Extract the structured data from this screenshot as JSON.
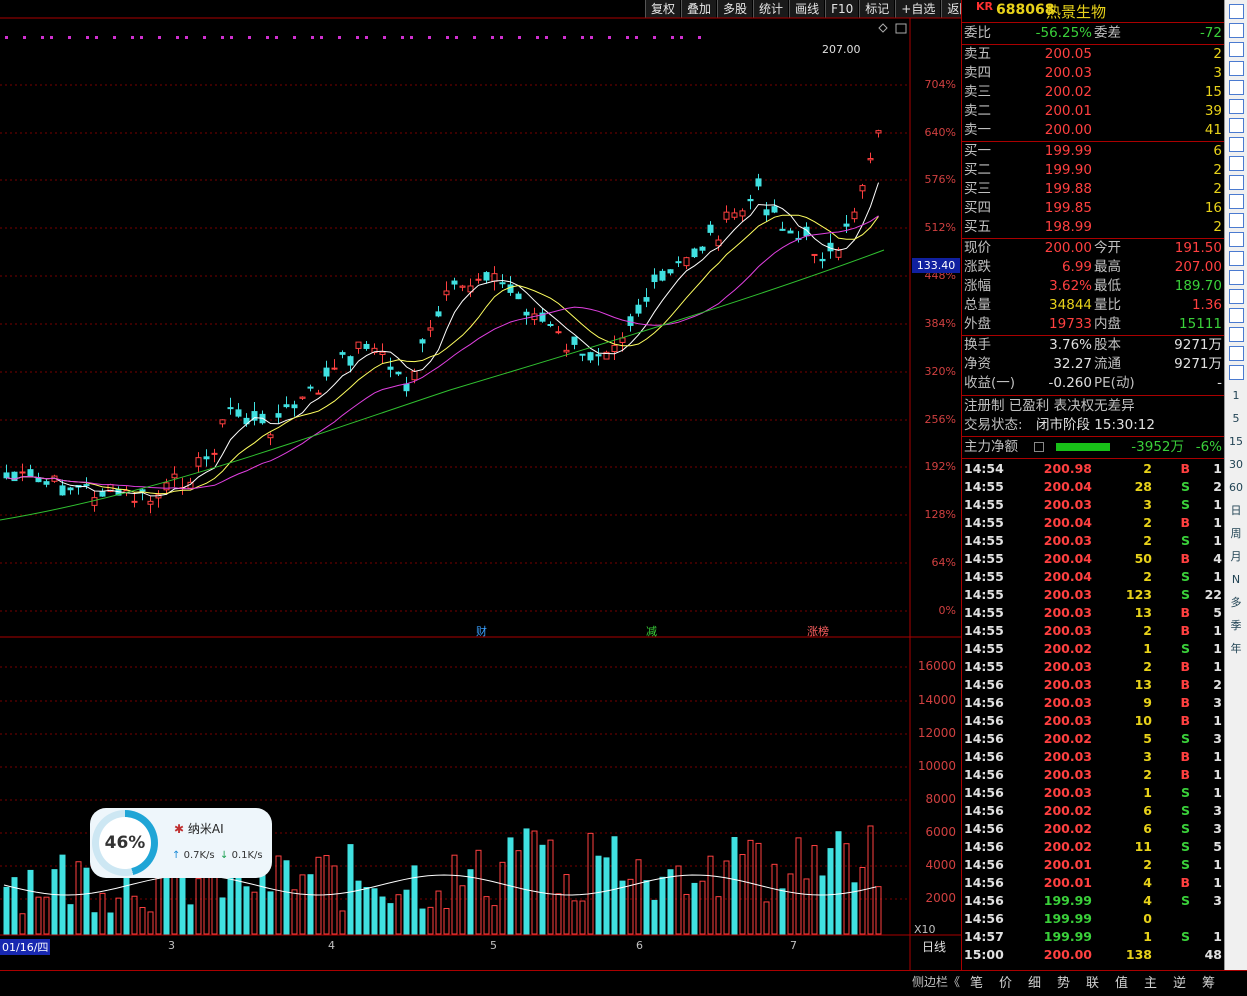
{
  "toolbar": [
    "复权",
    "叠加",
    "多股",
    "统计",
    "画线",
    "F10",
    "标记",
    "+自选",
    "返回"
  ],
  "header": {
    "market": "KR",
    "code": "688068",
    "name": "热景生物"
  },
  "quote": {
    "weibi_label": "委比",
    "weibi": "-56.25%",
    "weicha_label": "委差",
    "weicha": "-72",
    "asks": [
      {
        "l": "卖五",
        "p": "200.05",
        "v": "2"
      },
      {
        "l": "卖四",
        "p": "200.03",
        "v": "3"
      },
      {
        "l": "卖三",
        "p": "200.02",
        "v": "15"
      },
      {
        "l": "卖二",
        "p": "200.01",
        "v": "39"
      },
      {
        "l": "卖一",
        "p": "200.00",
        "v": "41"
      }
    ],
    "bids": [
      {
        "l": "买一",
        "p": "199.99",
        "v": "6"
      },
      {
        "l": "买二",
        "p": "199.90",
        "v": "2"
      },
      {
        "l": "买三",
        "p": "199.88",
        "v": "2"
      },
      {
        "l": "买四",
        "p": "199.85",
        "v": "16"
      },
      {
        "l": "买五",
        "p": "198.99",
        "v": "2"
      }
    ],
    "stats": [
      {
        "l1": "现价",
        "v1": "200.00",
        "l2": "今开",
        "v2": "191.50",
        "c1": "#ff4040",
        "c2": "#ff4040"
      },
      {
        "l1": "涨跌",
        "v1": "6.99",
        "l2": "最高",
        "v2": "207.00",
        "c1": "#ff4040",
        "c2": "#ff4040"
      },
      {
        "l1": "涨幅",
        "v1": "3.62%",
        "l2": "最低",
        "v2": "189.70",
        "c1": "#ff4040",
        "c2": "#3ad03a"
      },
      {
        "l1": "总量",
        "v1": "34844",
        "l2": "量比",
        "v2": "1.36",
        "c1": "#e8d21a",
        "c2": "#ff4040"
      },
      {
        "l1": "外盘",
        "v1": "19733",
        "l2": "内盘",
        "v2": "15111",
        "c1": "#ff4040",
        "c2": "#3ad03a"
      }
    ],
    "stats2": [
      {
        "l1": "换手",
        "v1": "3.76%",
        "l2": "股本",
        "v2": "9271万"
      },
      {
        "l1": "净资",
        "v1": "32.27",
        "l2": "流通",
        "v2": "9271万"
      },
      {
        "l1": "收益(一)",
        "v1": "-0.260",
        "l2": "PE(动)",
        "v2": "-"
      }
    ],
    "reg": "注册制 已盈利 表决权无差异",
    "status_label": "交易状态:",
    "status": "闭市阶段 15:30:12",
    "zl_label": "主力净额",
    "zl_value": "-3952万",
    "zl_pct": "-6%"
  },
  "ticks": [
    [
      "14:54",
      "200.98",
      "2",
      "B",
      "1"
    ],
    [
      "14:55",
      "200.04",
      "28",
      "S",
      "2"
    ],
    [
      "14:55",
      "200.03",
      "3",
      "S",
      "1"
    ],
    [
      "14:55",
      "200.04",
      "2",
      "B",
      "1"
    ],
    [
      "14:55",
      "200.03",
      "2",
      "S",
      "1"
    ],
    [
      "14:55",
      "200.04",
      "50",
      "B",
      "4"
    ],
    [
      "14:55",
      "200.04",
      "2",
      "S",
      "1"
    ],
    [
      "14:55",
      "200.03",
      "123",
      "S",
      "22"
    ],
    [
      "14:55",
      "200.03",
      "13",
      "B",
      "5"
    ],
    [
      "14:55",
      "200.03",
      "2",
      "B",
      "1"
    ],
    [
      "14:55",
      "200.02",
      "1",
      "S",
      "1"
    ],
    [
      "14:55",
      "200.03",
      "2",
      "B",
      "1"
    ],
    [
      "14:56",
      "200.03",
      "13",
      "B",
      "2"
    ],
    [
      "14:56",
      "200.03",
      "9",
      "B",
      "3"
    ],
    [
      "14:56",
      "200.03",
      "10",
      "B",
      "1"
    ],
    [
      "14:56",
      "200.02",
      "5",
      "S",
      "3"
    ],
    [
      "14:56",
      "200.03",
      "3",
      "B",
      "1"
    ],
    [
      "14:56",
      "200.03",
      "2",
      "B",
      "1"
    ],
    [
      "14:56",
      "200.03",
      "1",
      "S",
      "1"
    ],
    [
      "14:56",
      "200.02",
      "6",
      "S",
      "3"
    ],
    [
      "14:56",
      "200.02",
      "6",
      "S",
      "3"
    ],
    [
      "14:56",
      "200.02",
      "11",
      "S",
      "5"
    ],
    [
      "14:56",
      "200.01",
      "2",
      "S",
      "1"
    ],
    [
      "14:56",
      "200.01",
      "4",
      "B",
      "1"
    ],
    [
      "14:56",
      "199.99",
      "4",
      "S",
      "3"
    ],
    [
      "14:56",
      "199.99",
      "0",
      "",
      ""
    ],
    [
      "14:57",
      "199.99",
      "1",
      "S",
      "1"
    ],
    [
      "15:00",
      "200.00",
      "138",
      "",
      "48"
    ]
  ],
  "price_axis": [
    "704%",
    "640%",
    "576%",
    "512%",
    "448%",
    "384%",
    "320%",
    "256%",
    "192%",
    "128%",
    "64%",
    "0%"
  ],
  "high_label": "207.00",
  "cur_price": "133.40",
  "vol_axis": [
    "16000",
    "14000",
    "12000",
    "10000",
    "8000",
    "6000",
    "4000",
    "2000"
  ],
  "vol_unit": "X10",
  "date_labels": [
    {
      "t": "01/16/四"
    },
    {
      "t": "3"
    },
    {
      "t": "4"
    },
    {
      "t": "5"
    },
    {
      "t": "6"
    },
    {
      "t": "7"
    }
  ],
  "markers": [
    {
      "t": "财",
      "c": "#3aa0ff"
    },
    {
      "t": "减",
      "c": "#3ad03a"
    },
    {
      "t": "涨榜",
      "c": "#ff6060"
    }
  ],
  "period_label": "日线",
  "sidebar_toggle": "侧边栏《",
  "bottom_tabs": [
    "笔",
    "价",
    "细",
    "势",
    "联",
    "值",
    "主",
    "逆",
    "筹"
  ],
  "side_texts": [
    "1",
    "5",
    "15",
    "30",
    "60",
    "日",
    "周",
    "月",
    "N",
    "多",
    "季",
    "年"
  ],
  "ai": {
    "pct": "46%",
    "name": "纳米AI",
    "up": "0.7K/s",
    "down": "0.1K/s"
  }
}
